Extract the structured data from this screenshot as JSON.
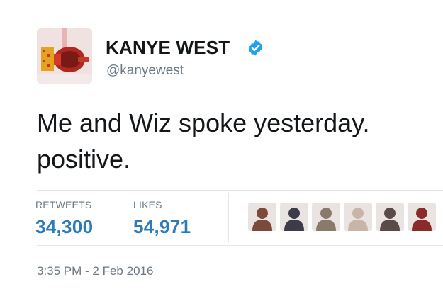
{
  "author": {
    "display_name": "KANYE WEST",
    "handle": "@kanyewest",
    "verified": true,
    "avatar_icon": "profile-avatar-icon"
  },
  "tweet": {
    "text": "Me and Wiz spoke yesterday.\npositive."
  },
  "stats": {
    "retweets_label": "RETWEETS",
    "retweets_count": "34,300",
    "likes_label": "LIKES",
    "likes_count": "54,971"
  },
  "liked_by": [
    {
      "name": "liker-avatar-1",
      "bg": "#7b4a3a"
    },
    {
      "name": "liker-avatar-2",
      "bg": "#3b3b4a"
    },
    {
      "name": "liker-avatar-3",
      "bg": "#8a7a6a"
    },
    {
      "name": "liker-avatar-4",
      "bg": "#c9b5a8"
    },
    {
      "name": "liker-avatar-5",
      "bg": "#5a4a48"
    },
    {
      "name": "liker-avatar-6",
      "bg": "#8a2a2a"
    }
  ],
  "timestamp": "3:35 PM - 2 Feb 2016",
  "colors": {
    "link_blue": "#2b7bb9",
    "verified_blue": "#1da1f2",
    "secondary_text": "#6b7884"
  }
}
